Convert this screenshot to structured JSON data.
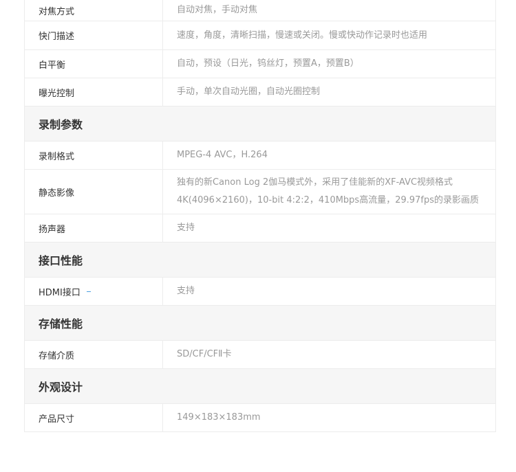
{
  "spec_rows": [
    {
      "kind": "row",
      "label": "对焦方式",
      "values": [
        "自动对焦，手动对焦"
      ]
    },
    {
      "kind": "row",
      "label": "快门描述",
      "values": [
        "速度，角度，清晰扫描，慢速或关闭。慢或快动作记录时也适用"
      ]
    },
    {
      "kind": "row",
      "label": "白平衡",
      "values": [
        "自动，预设（日光，钨丝灯，预置A，预置B）"
      ]
    },
    {
      "kind": "row",
      "label": "曝光控制",
      "values": [
        "手动，单次自动光圈，自动光圈控制"
      ]
    },
    {
      "kind": "section",
      "label": "录制参数"
    },
    {
      "kind": "row",
      "label": "录制格式",
      "values": [
        "MPEG-4 AVC，H.264"
      ]
    },
    {
      "kind": "row",
      "label": "静态影像",
      "values": [
        "独有的新Canon Log 2伽马模式外，采用了佳能新的XF-AVC视频格式",
        "4K(4096×2160)，10-bit 4:2:2，410Mbps高流量，29.97fps的录影画质"
      ]
    },
    {
      "kind": "row",
      "label": "扬声器",
      "values": [
        "支持"
      ]
    },
    {
      "kind": "section",
      "label": "接口性能"
    },
    {
      "kind": "row",
      "label": "HDMI接口",
      "values": [
        "支持"
      ],
      "mark": true
    },
    {
      "kind": "section",
      "label": "存储性能"
    },
    {
      "kind": "row",
      "label": "存储介质",
      "values": [
        "SD/CF/CFⅡ卡"
      ]
    },
    {
      "kind": "section",
      "label": "外观设计"
    },
    {
      "kind": "row",
      "label": "产品尺寸",
      "values": [
        "149×183×183mm"
      ]
    }
  ]
}
